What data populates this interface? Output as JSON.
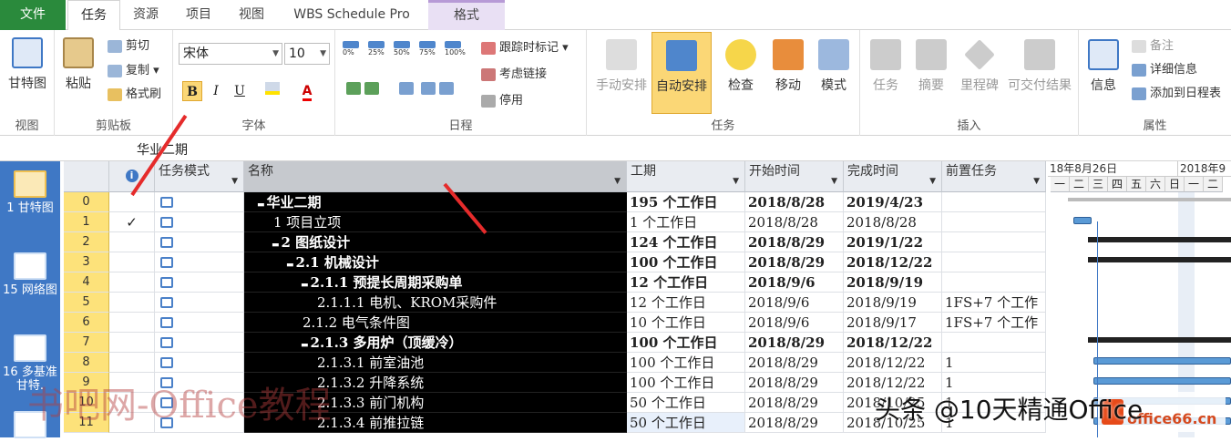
{
  "tabs": [
    "文件",
    "任务",
    "资源",
    "项目",
    "视图",
    "WBS Schedule Pro",
    "格式"
  ],
  "ribbon": {
    "gantt_label": "甘特图",
    "view_group": "视图",
    "paste_label": "粘贴",
    "cut": "剪切",
    "copy": "复制",
    "format_painter": "格式刷",
    "clipboard_group": "剪贴板",
    "font_name": "宋体",
    "font_size": "10",
    "font_group": "字体",
    "bold": "B",
    "italic": "I",
    "underline": "U",
    "pct": [
      "0%",
      "25%",
      "50%",
      "75%",
      "100%"
    ],
    "track": "跟踪时标记",
    "respect_links": "考虑链接",
    "inactivate": "停用",
    "schedule_group": "日程",
    "manual": "手动安排",
    "auto": "自动安排",
    "inspect": "检查",
    "move": "移动",
    "mode": "模式",
    "tasks_group": "任务",
    "task": "任务",
    "summary": "摘要",
    "milestone": "里程碑",
    "deliverable": "可交付结果",
    "insert_group": "插入",
    "info": "信息",
    "notes": "备注",
    "details": "详细信息",
    "add_timeline": "添加到日程表",
    "props_group": "属性"
  },
  "formula_bar": "华业二期",
  "views": [
    {
      "num": "1",
      "label": "甘特图"
    },
    {
      "num": "15",
      "label": "网络图"
    },
    {
      "num": "16",
      "label": "多基准甘特."
    }
  ],
  "columns": {
    "mode": "任务模式",
    "name": "名称",
    "duration": "工期",
    "start": "开始时间",
    "finish": "完成时间",
    "pred": "前置任务"
  },
  "rows": [
    {
      "id": "0",
      "check": "",
      "name": "华业二期",
      "prefix": "▬",
      "indent": 0,
      "bold": true,
      "duration": "195 个工作日",
      "start": "2018/8/28",
      "finish": "2019/4/23",
      "pred": ""
    },
    {
      "id": "1",
      "check": "✓",
      "name": "1 项目立项",
      "prefix": "",
      "indent": 1,
      "bold": false,
      "duration": "1 个工作日",
      "start": "2018/8/28",
      "finish": "2018/8/28",
      "pred": ""
    },
    {
      "id": "2",
      "check": "",
      "name": "2 图纸设计",
      "prefix": "▬",
      "indent": 1,
      "bold": true,
      "duration": "124 个工作日",
      "start": "2018/8/29",
      "finish": "2019/1/22",
      "pred": ""
    },
    {
      "id": "3",
      "check": "",
      "name": "2.1 机械设计",
      "prefix": "▬",
      "indent": 2,
      "bold": true,
      "duration": "100 个工作日",
      "start": "2018/8/29",
      "finish": "2018/12/22",
      "pred": ""
    },
    {
      "id": "4",
      "check": "",
      "name": "2.1.1  预提长周期采购单",
      "prefix": "▬",
      "indent": 3,
      "bold": true,
      "duration": "12 个工作日",
      "start": "2018/9/6",
      "finish": "2018/9/19",
      "pred": ""
    },
    {
      "id": "5",
      "check": "",
      "name": "2.1.1.1  电机、KROM采购件",
      "prefix": "",
      "indent": 4,
      "bold": false,
      "duration": "12 个工作日",
      "start": "2018/9/6",
      "finish": "2018/9/19",
      "pred": "1FS+7 个工作"
    },
    {
      "id": "6",
      "check": "",
      "name": "2.1.2  电气条件图",
      "prefix": "",
      "indent": 3,
      "bold": false,
      "duration": "10 个工作日",
      "start": "2018/9/6",
      "finish": "2018/9/17",
      "pred": "1FS+7 个工作"
    },
    {
      "id": "7",
      "check": "",
      "name": "2.1.3  多用炉（顶缓冷）",
      "prefix": "▬",
      "indent": 3,
      "bold": true,
      "duration": "100 个工作日",
      "start": "2018/8/29",
      "finish": "2018/12/22",
      "pred": ""
    },
    {
      "id": "8",
      "check": "",
      "name": "2.1.3.1  前室油池",
      "prefix": "",
      "indent": 4,
      "bold": false,
      "duration": "100 个工作日",
      "start": "2018/8/29",
      "finish": "2018/12/22",
      "pred": "1"
    },
    {
      "id": "9",
      "check": "",
      "name": "2.1.3.2  升降系统",
      "prefix": "",
      "indent": 4,
      "bold": false,
      "duration": "100 个工作日",
      "start": "2018/8/29",
      "finish": "2018/12/22",
      "pred": "1"
    },
    {
      "id": "10",
      "check": "",
      "name": "2.1.3.3  前门机构",
      "prefix": "",
      "indent": 4,
      "bold": false,
      "duration": "50 个工作日",
      "start": "2018/8/29",
      "finish": "2018/10/25",
      "pred": "1"
    },
    {
      "id": "11",
      "check": "",
      "name": "2.1.3.4  前推拉链",
      "prefix": "",
      "indent": 4,
      "bold": false,
      "duration": "50 个工作日",
      "start": "2018/8/29",
      "finish": "2018/10/25",
      "pred": "1"
    }
  ],
  "gantt": {
    "week1": "18年8月26日",
    "week2": "2018年9",
    "days": [
      "一",
      "二",
      "三",
      "四",
      "五",
      "六",
      "日",
      "一",
      "二"
    ]
  },
  "watermarks": {
    "left": "书吧网-Office教程",
    "right": "头条 @10天精通Office",
    "logo": "office66.cn"
  }
}
